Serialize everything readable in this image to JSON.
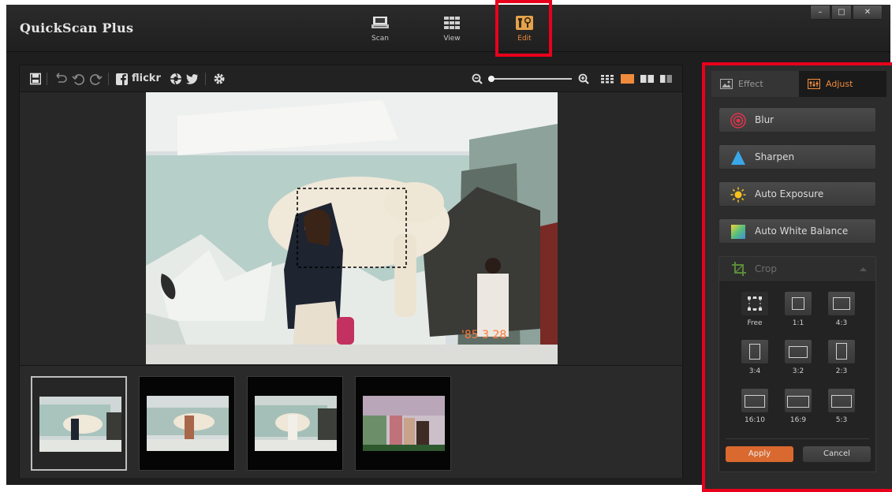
{
  "app": {
    "title": "QuickScan Plus"
  },
  "modes": [
    {
      "label": "Scan"
    },
    {
      "label": "View"
    },
    {
      "label": "Edit"
    }
  ],
  "window_controls": {
    "minimize": "–",
    "maximize": "□",
    "close": "✕"
  },
  "toolbar": {
    "flickr_label": "flickr",
    "zoom_percent": 0
  },
  "photo": {
    "date_stamp": "'85 3 28"
  },
  "thumbnails": [
    {
      "selected": true
    },
    {
      "selected": false
    },
    {
      "selected": false
    },
    {
      "selected": false
    }
  ],
  "panel": {
    "tabs": [
      {
        "label": "Effect"
      },
      {
        "label": "Adjust",
        "active": true
      }
    ],
    "buttons": [
      {
        "label": "Blur",
        "icon": "blur-icon"
      },
      {
        "label": "Sharpen",
        "icon": "sharpen-icon"
      },
      {
        "label": "Auto Exposure",
        "icon": "sun-icon"
      },
      {
        "label": "Auto White Balance",
        "icon": "white-balance-icon"
      }
    ],
    "crop": {
      "title": "Crop",
      "ratios": [
        "Free",
        "1:1",
        "4:3",
        "3:4",
        "3:2",
        "2:3",
        "16:10",
        "16:9",
        "5:3"
      ],
      "apply_label": "Apply",
      "cancel_label": "Cancel"
    }
  },
  "colors": {
    "accent": "#f08a3c",
    "highlight": "#e8001c",
    "apply": "#d9692e"
  }
}
